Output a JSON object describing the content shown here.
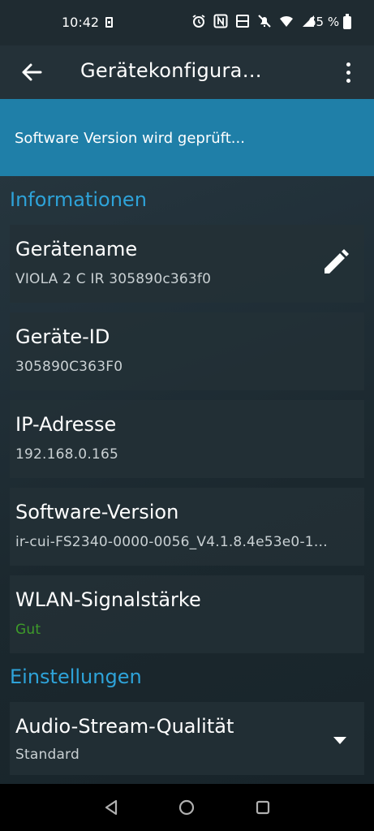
{
  "status_bar": {
    "time": "10:42",
    "battery": "65 %",
    "icons": [
      "alarm-icon",
      "nfc-icon",
      "volte-icon",
      "mute-icon",
      "wifi-icon",
      "signal-icon"
    ]
  },
  "toolbar": {
    "title": "Gerätekonfigura…",
    "back_icon": "arrow-left-icon",
    "menu_icon": "more-vert-icon"
  },
  "banner": {
    "text": "Software Version wird geprüft..."
  },
  "sections": {
    "info_header": "Informationen",
    "settings_header": "Einstellungen"
  },
  "info": {
    "device_name": {
      "title": "Gerätename",
      "value": "VIOLA 2 C IR 305890c363f0",
      "icon": "edit-icon"
    },
    "device_id": {
      "title": "Geräte-ID",
      "value": "305890C363F0"
    },
    "ip_address": {
      "title": "IP-Adresse",
      "value": "192.168.0.165"
    },
    "software_version": {
      "title": "Software-Version",
      "value": "ir-cui-FS2340-0000-0056_V4.1.8.4e53e0-1…"
    },
    "wlan_signal": {
      "title": "WLAN-Signalstärke",
      "value": "Gut"
    }
  },
  "settings": {
    "audio_quality": {
      "title": "Audio-Stream-Qualität",
      "value": "Standard",
      "icon": "dropdown-arrow-icon"
    }
  },
  "colors": {
    "accent": "#2ea3d9",
    "banner": "#1f7fa8",
    "good": "#3e9b2a"
  },
  "nav": [
    "back-triangle-icon",
    "home-circle-icon",
    "recents-square-icon"
  ]
}
